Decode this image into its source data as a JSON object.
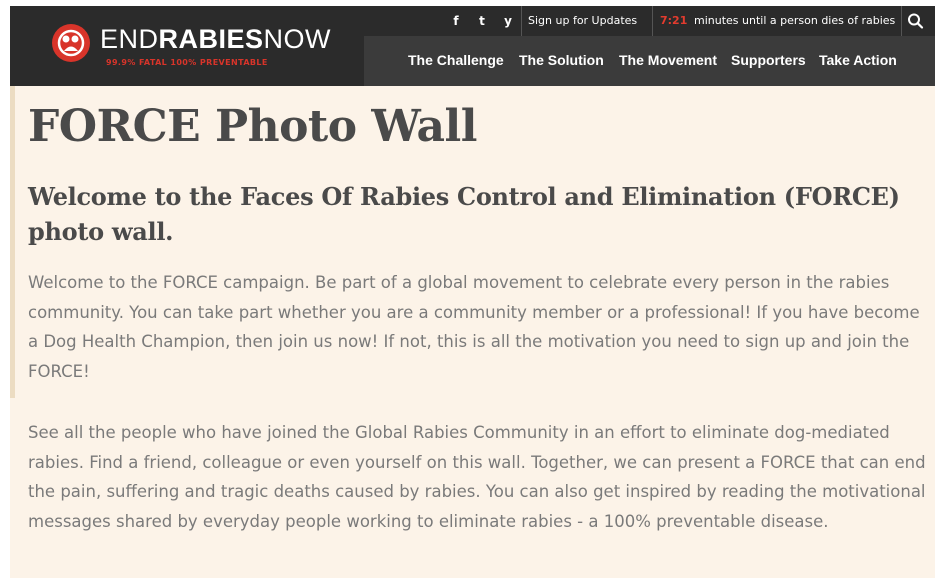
{
  "header": {
    "logo": {
      "part1": "END",
      "part2": "RABIES",
      "part3": "NOW",
      "tagline": "99.9% FATAL  100% PREVENTABLE",
      "brand_color": "#d8342a"
    },
    "social_icons": [
      "facebook-icon",
      "twitter-icon",
      "youtube-icon"
    ],
    "social_glyphs": [
      "f",
      "t",
      "y"
    ],
    "signup_label": "Sign up for Updates",
    "timer_value": "7:21",
    "timer_text": "minutes until a person dies of rabies",
    "nav": [
      "The Challenge",
      "The Solution",
      "The Movement",
      "Supporters",
      "Take Action"
    ]
  },
  "main": {
    "title": "FORCE Photo Wall",
    "subtitle": "Welcome to the Faces Of Rabies Control and Elimination (FORCE) photo wall.",
    "paragraphs": [
      "Welcome to the FORCE campaign. Be part of a global movement to celebrate every person in the rabies community. You can take part whether you are a community member or a professional! If you have become a Dog Health Champion, then join us now! If not, this is all the motivation you need to sign up and join the FORCE!",
      "See all the people who have joined the Global Rabies Community in an effort to eliminate dog-mediated rabies. Find a friend, colleague or even yourself on this wall. Together, we can present a FORCE that can end the pain, suffering and tragic deaths caused by rabies. You can also get inspired by reading the motivational messages shared by everyday people working to eliminate rabies - a 100% preventable disease."
    ]
  }
}
